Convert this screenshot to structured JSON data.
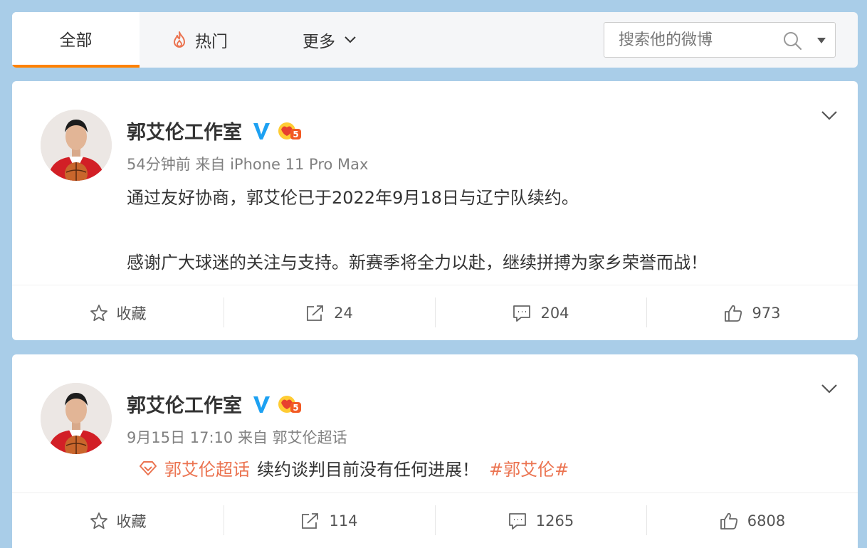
{
  "tabs": {
    "all": "全部",
    "hot": "热门",
    "more": "更多"
  },
  "search": {
    "placeholder": "搜索他的微博"
  },
  "colors": {
    "accent": "#ff8200",
    "verified": "#1da1f2",
    "link": "#eb7350"
  },
  "posts": [
    {
      "author": "郭艾伦工作室",
      "level": "5",
      "meta": "54分钟前 来自 iPhone 11 Pro Max",
      "text_line1": "通过友好协商，郭艾伦已于2022年9月18日与辽宁队续约。",
      "text_line2": "感谢广大球迷的关注与支持。新赛季将全力以赴，继续拼搏为家乡荣誉而战！",
      "actions": {
        "favorite": "收藏",
        "repost": "24",
        "comment": "204",
        "like": "973"
      }
    },
    {
      "author": "郭艾伦工作室",
      "level": "5",
      "meta": "9月15日 17:10 来自 郭艾伦超话",
      "topic": "郭艾伦超话",
      "body": "续约谈判目前没有任何进展！",
      "hashtag": "#郭艾伦#",
      "actions": {
        "favorite": "收藏",
        "repost": "114",
        "comment": "1265",
        "like": "6808"
      }
    }
  ]
}
